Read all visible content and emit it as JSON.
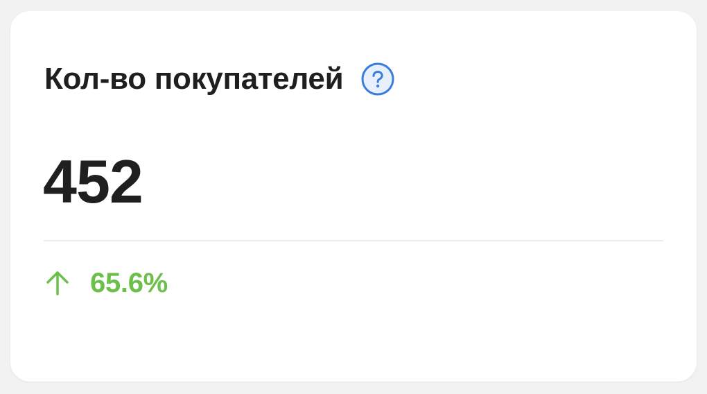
{
  "card": {
    "title": "Кол-во покупателей",
    "help_icon": "question-circle-icon",
    "value": "452",
    "trend": {
      "direction_icon": "arrow-up-icon",
      "value": "65.6%",
      "color": "#6cc04a"
    }
  },
  "colors": {
    "accent": "#3b7ddd",
    "positive": "#6cc04a",
    "text": "#1f1f1f",
    "background": "#f2f2f2",
    "card": "#ffffff"
  }
}
